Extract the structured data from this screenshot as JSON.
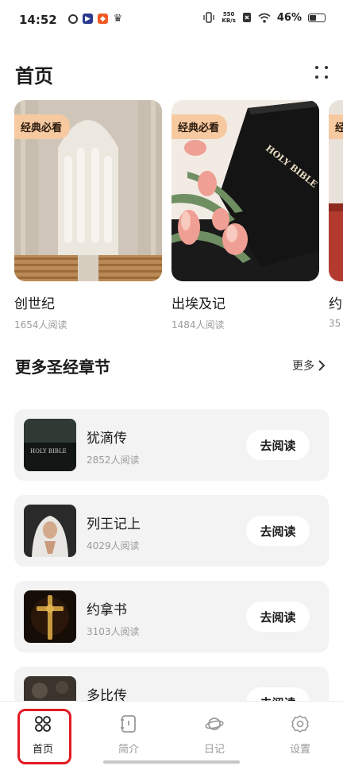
{
  "status_bar": {
    "time": "14:52",
    "net_speed_value": "550",
    "net_speed_unit": "KB/s",
    "battery": "46%"
  },
  "header": {
    "title": "首页"
  },
  "featured": [
    {
      "badge": "经典必看",
      "title": "创世纪",
      "readers": "1654人阅读"
    },
    {
      "badge": "经典必看",
      "title": "出埃及记",
      "readers": "1484人阅读"
    },
    {
      "badge": "经",
      "title": "约",
      "readers": "35"
    }
  ],
  "section": {
    "title": "更多圣经章节",
    "more_label": "更多"
  },
  "list": [
    {
      "name": "犹滴传",
      "count": "2852人阅读",
      "button": "去阅读"
    },
    {
      "name": "列王记上",
      "count": "4029人阅读",
      "button": "去阅读"
    },
    {
      "name": "约拿书",
      "count": "3103人阅读",
      "button": "去阅读"
    },
    {
      "name": "多比传",
      "count": "",
      "button": "去阅读"
    }
  ],
  "bottom_nav": [
    {
      "label": "首页",
      "icon": "grid-icon",
      "active": true
    },
    {
      "label": "简介",
      "icon": "book-icon",
      "active": false
    },
    {
      "label": "日记",
      "icon": "planet-icon",
      "active": false
    },
    {
      "label": "设置",
      "icon": "gear-icon",
      "active": false
    }
  ],
  "thumb_text": {
    "bible_cover": "HOLY BIBLE"
  },
  "colors": {
    "badge_bg": "#f6c9a0",
    "row_bg": "#f3f3f3",
    "highlight": "#e21b24"
  }
}
